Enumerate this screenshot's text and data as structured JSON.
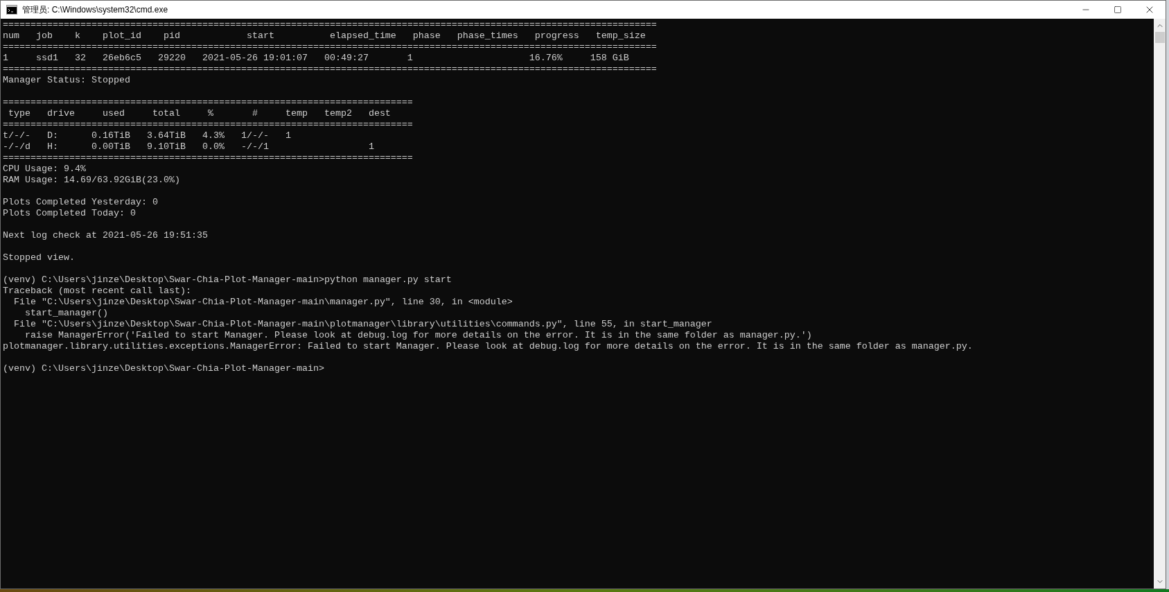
{
  "window": {
    "title": "管理员: C:\\Windows\\system32\\cmd.exe"
  },
  "console": {
    "blocks": [
      [
        "======================================================================================================================",
        "num   job    k    plot_id    pid            start          elapsed_time   phase   phase_times   progress   temp_size",
        "======================================================================================================================",
        "1     ssd1   32   26eb6c5   29220   2021-05-26 19:01:07   00:49:27       1                     16.76%     158 GiB",
        "======================================================================================================================",
        "Manager Status: Stopped"
      ],
      [
        "==========================================================================",
        " type   drive     used     total     %       #     temp   temp2   dest",
        "==========================================================================",
        "t/-/-   D:      0.16TiB   3.64TiB   4.3%   1/-/-   1",
        "-/-/d   H:      0.00TiB   9.10TiB   0.0%   -/-/1                  1",
        "==========================================================================",
        "CPU Usage: 9.4%",
        "RAM Usage: 14.69/63.92GiB(23.0%)"
      ],
      [
        "Plots Completed Yesterday: 0",
        "Plots Completed Today: 0"
      ],
      [
        "Next log check at 2021-05-26 19:51:35"
      ],
      [
        "Stopped view."
      ],
      [
        "(venv) C:\\Users\\jinze\\Desktop\\Swar-Chia-Plot-Manager-main>python manager.py start",
        "Traceback (most recent call last):",
        "  File \"C:\\Users\\jinze\\Desktop\\Swar-Chia-Plot-Manager-main\\manager.py\", line 30, in <module>",
        "    start_manager()",
        "  File \"C:\\Users\\jinze\\Desktop\\Swar-Chia-Plot-Manager-main\\plotmanager\\library\\utilities\\commands.py\", line 55, in start_manager",
        "    raise ManagerError('Failed to start Manager. Please look at debug.log for more details on the error. It is in the same folder as manager.py.')",
        "plotmanager.library.utilities.exceptions.ManagerError: Failed to start Manager. Please look at debug.log for more details on the error. It is in the same folder as manager.py."
      ],
      [
        "(venv) C:\\Users\\jinze\\Desktop\\Swar-Chia-Plot-Manager-main>"
      ]
    ]
  }
}
